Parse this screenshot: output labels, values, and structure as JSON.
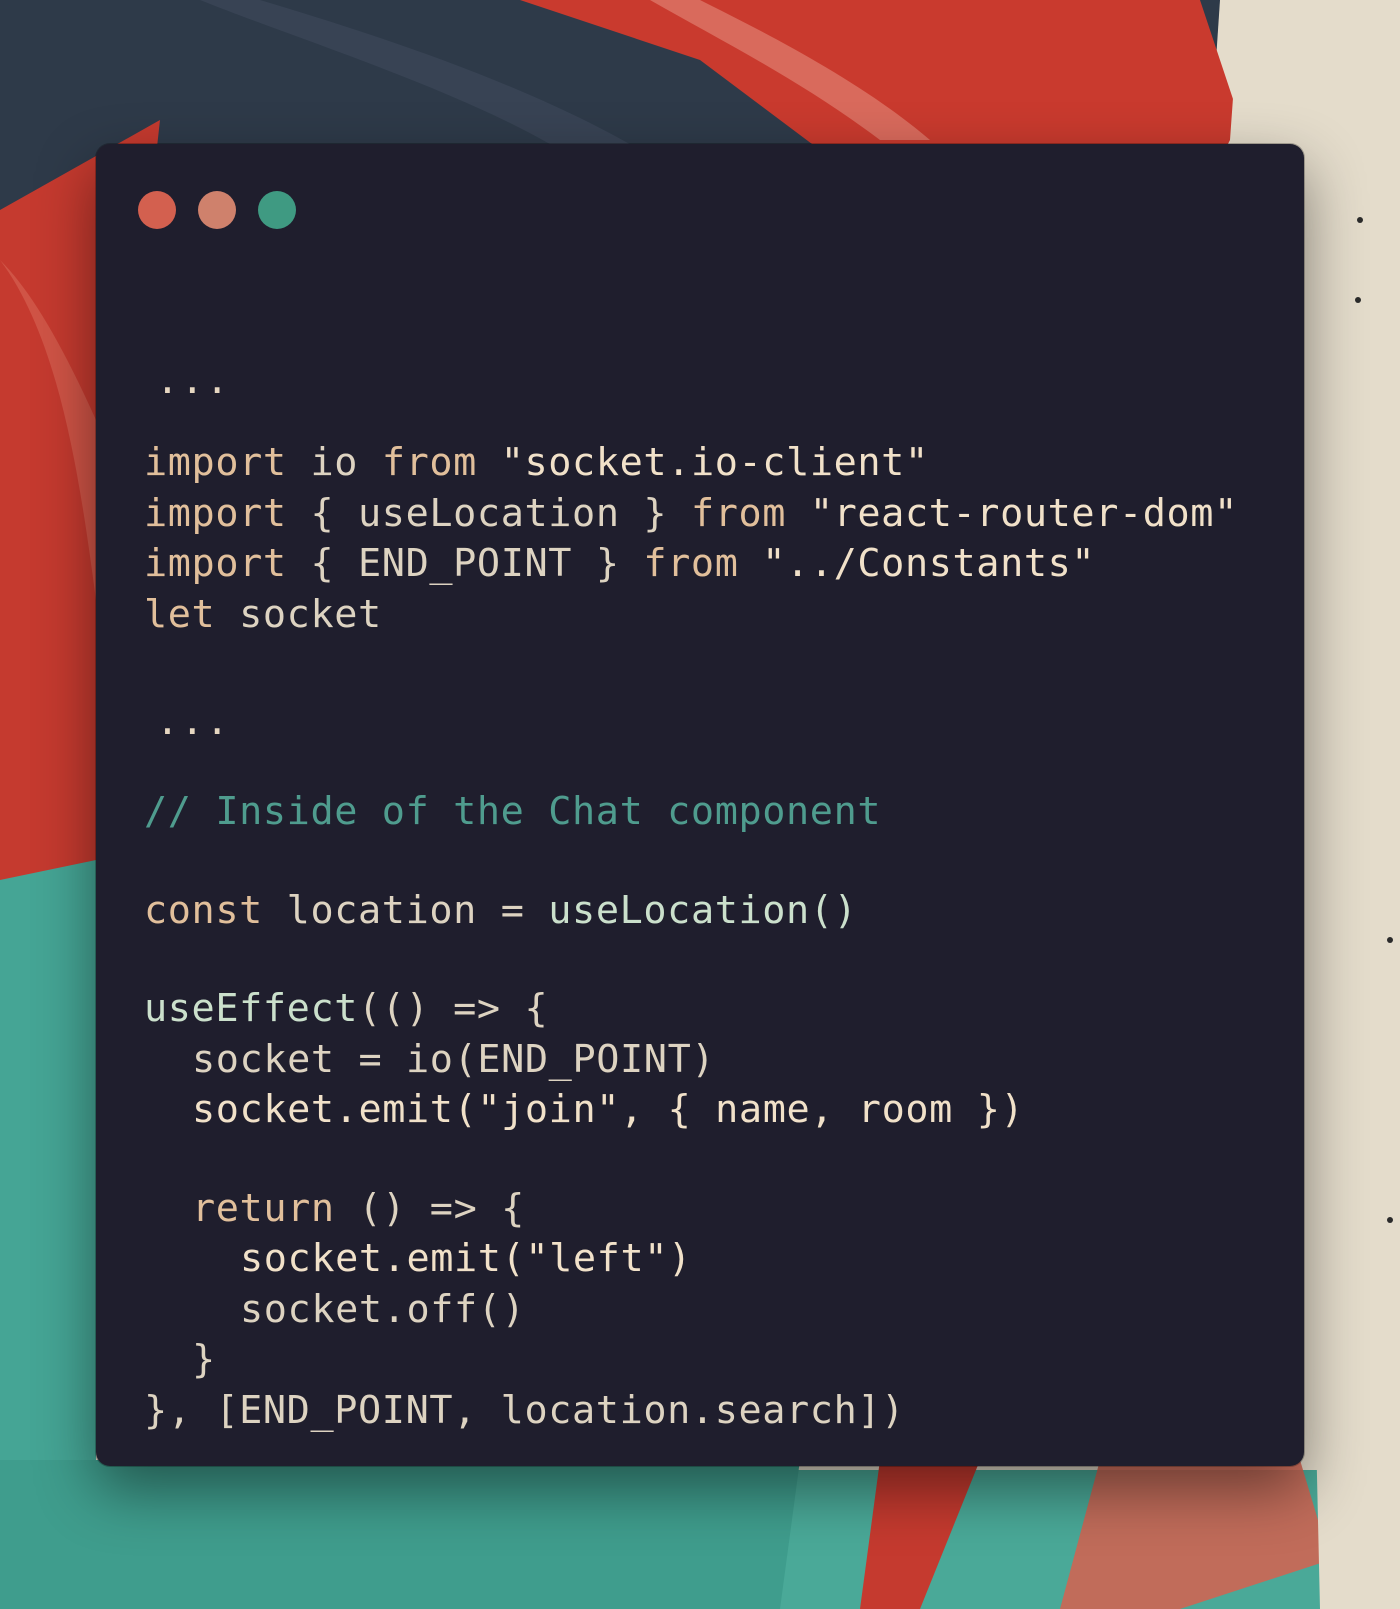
{
  "colors": {
    "window_background": "#1f1e2d",
    "keyword": "#e1bf9b",
    "string": "#f1e1c9",
    "comment": "#4f9c8e",
    "identifier": "#ddd3c1",
    "close_dot": "#d3604f",
    "minimize_dot": "#cf816c",
    "maximize_dot": "#3f9a82"
  },
  "window_controls": [
    {
      "name": "close-dot",
      "color": "#d3604f"
    },
    {
      "name": "minimize-dot",
      "color": "#cf816c"
    },
    {
      "name": "maximize-dot",
      "color": "#3f9a82"
    }
  ],
  "code": {
    "ellipsis_top": "...",
    "ellipsis_middle": "...",
    "lines": [
      {
        "kw1": "import",
        "id1": " io ",
        "kw2": "from",
        "str": " \"socket.io-client\""
      },
      {
        "kw1": "import",
        "id1": " { useLocation } ",
        "kw2": "from",
        "str": " \"react-router-dom\""
      },
      {
        "kw1": "import",
        "id1": " { END_POINT } ",
        "kw2": "from",
        "str": " \"../Constants\""
      },
      {
        "kw1": "let",
        "id1": " socket"
      }
    ],
    "comment": "// Inside of the Chat component",
    "const_line": {
      "kw": "const",
      "rest": " location = ",
      "fn": "useLocation()"
    },
    "effect_open": {
      "fn": "useEffect",
      "rest": "(() => {"
    },
    "socket_assign": "socket = io(END_POINT)",
    "socket_join": "socket.emit(\"join\", { name, room })",
    "return_line": {
      "kw": "return",
      "rest": " () => {"
    },
    "socket_left": "socket.emit(\"left\")",
    "socket_off": "socket.off()",
    "inner_close": "}",
    "effect_close": "}, [END_POINT, location.search])"
  }
}
